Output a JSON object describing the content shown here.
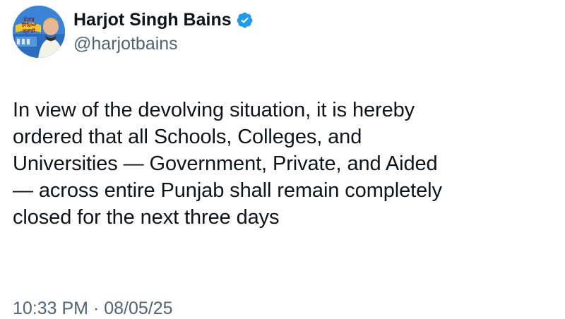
{
  "tweet": {
    "author": {
      "display_name": "Harjot Singh Bains",
      "handle": "@harjotbains",
      "verified": true,
      "verified_icon": "verified-badge-icon",
      "avatar_text": "ਪੰਜਾਬ ਸਿੱਖਿਆ ਕ੍ਰਾਂਤੀ"
    },
    "text": "In view of the devolving situation, it is hereby\nordered that all Schools, Colleges, and\nUniversities — Government, Private, and Aided\n— across entire Punjab shall remain completely\nclosed for the next three days",
    "time": "10:33 PM",
    "separator": "·",
    "date": "08/05/25"
  },
  "colors": {
    "text_primary": "#0f1419",
    "text_secondary": "#536471",
    "verified_blue": "#1d9bf0",
    "background": "#ffffff"
  }
}
